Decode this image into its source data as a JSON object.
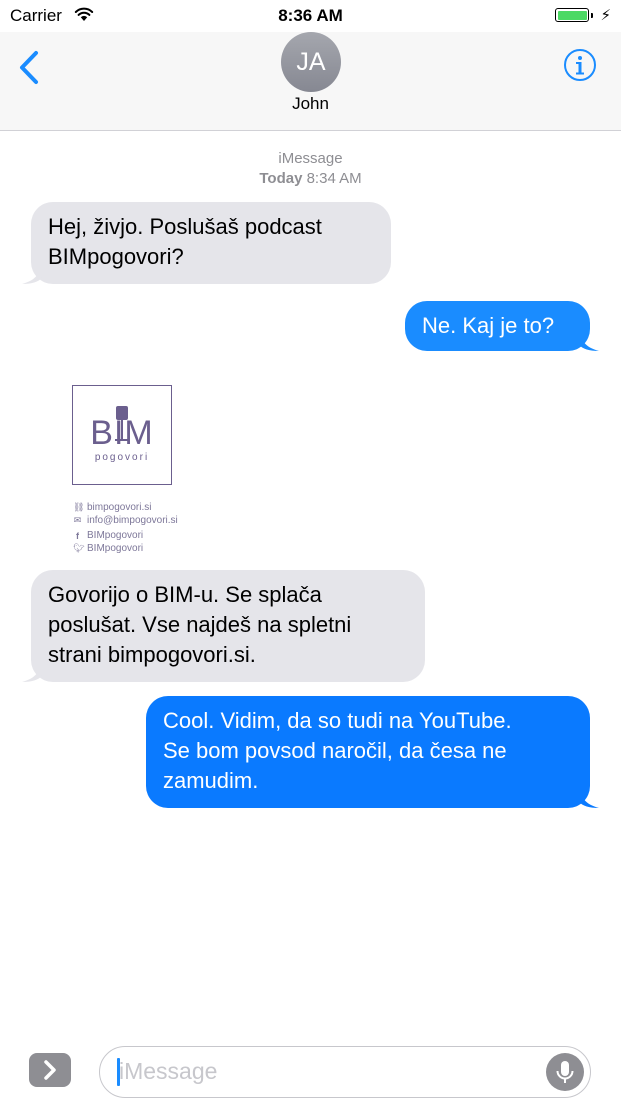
{
  "status_bar": {
    "carrier": "Carrier",
    "time": "8:36 AM",
    "battery_level": 1.0
  },
  "header": {
    "avatar_initials": "JA",
    "contact_name": "John"
  },
  "thread": {
    "service": "iMessage",
    "day": "Today",
    "time": "8:34 AM"
  },
  "messages": [
    {
      "from": "them",
      "lines": [
        "Hej, živjo. Poslušaš podcast",
        "BIMpogovori?"
      ]
    },
    {
      "from": "me",
      "lines": [
        "Ne. Kaj je to?"
      ]
    },
    {
      "from": "them",
      "lines": [
        "Govorijo o BIM-u. Se splača",
        "poslušat. Vse najdeš na spletni",
        "strani bimpogovori.si."
      ]
    },
    {
      "from": "me",
      "lines": [
        "Cool. Vidim, da so tudi na YouTube.",
        "Se bom povsod naročil, da česa ne",
        "zamudim."
      ]
    }
  ],
  "attachment": {
    "logo_text": "BIM",
    "logo_subtitle": "pogovori",
    "contacts": [
      {
        "icon": "link-icon",
        "text": "bimpogovori.si"
      },
      {
        "icon": "mail-icon",
        "text": "info@bimpogovori.si"
      },
      {
        "icon": "facebook-icon",
        "text": "BIMpogovori"
      },
      {
        "icon": "twitter-icon",
        "text": "BIMpogovori"
      }
    ]
  },
  "input": {
    "placeholder": "iMessage"
  },
  "colors": {
    "incoming_bubble": "#e5e5ea",
    "outgoing_bubble": "#1a8cff",
    "accent": "#1a8cff",
    "logo_purple": "#6b5f8e"
  }
}
